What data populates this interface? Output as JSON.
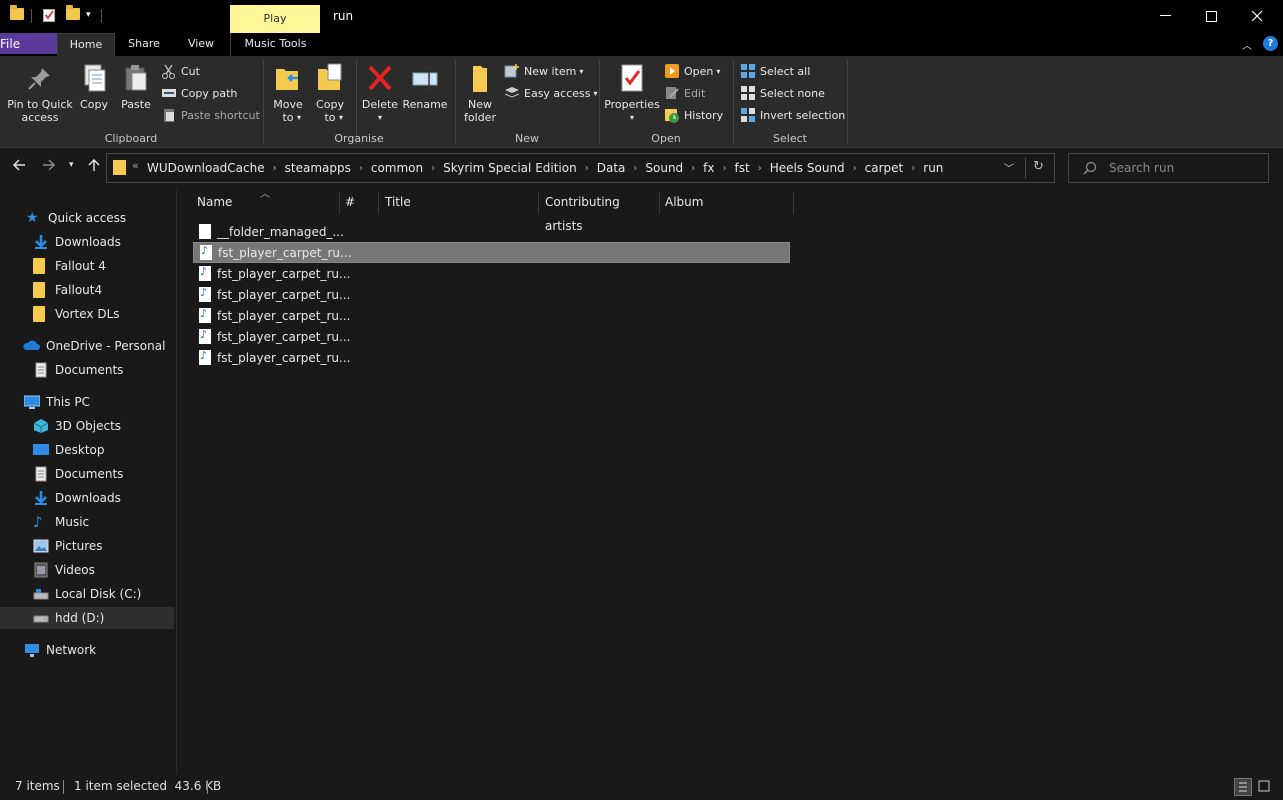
{
  "window": {
    "context_tab": "Play",
    "title": "run"
  },
  "tabs": {
    "file": "File",
    "home": "Home",
    "share": "Share",
    "view": "View",
    "music_tools": "Music Tools"
  },
  "ribbon": {
    "clipboard": {
      "label": "Clipboard",
      "pin": "Pin to Quick access",
      "copy": "Copy",
      "paste": "Paste",
      "cut": "Cut",
      "copy_path": "Copy path",
      "paste_shortcut": "Paste shortcut"
    },
    "organise": {
      "label": "Organise",
      "move_to": "Move to",
      "copy_to": "Copy to",
      "delete": "Delete",
      "rename": "Rename"
    },
    "new": {
      "label": "New",
      "new_folder": "New folder",
      "new_item": "New item",
      "easy_access": "Easy access"
    },
    "open": {
      "label": "Open",
      "properties": "Properties",
      "open": "Open",
      "edit": "Edit",
      "history": "History"
    },
    "select": {
      "label": "Select",
      "select_all": "Select all",
      "select_none": "Select none",
      "invert": "Invert selection"
    }
  },
  "address": {
    "crumbs": [
      "WUDownloadCache",
      "steamapps",
      "common",
      "Skyrim Special Edition",
      "Data",
      "Sound",
      "fx",
      "fst",
      "Heels Sound",
      "carpet",
      "run"
    ],
    "search_placeholder": "Search run"
  },
  "nav": {
    "quick_access": "Quick access",
    "qa_items": [
      "Downloads",
      "Fallout 4",
      "Fallout4",
      "Vortex DLs"
    ],
    "onedrive": "OneDrive - Personal",
    "onedrive_items": [
      "Documents"
    ],
    "this_pc": "This PC",
    "pc_items": [
      "3D Objects",
      "Desktop",
      "Documents",
      "Downloads",
      "Music",
      "Pictures",
      "Videos",
      "Local Disk (C:)",
      "hdd (D:)"
    ],
    "network": "Network"
  },
  "columns": [
    "Name",
    "#",
    "Title",
    "Contributing artists",
    "Album"
  ],
  "files": [
    {
      "name": "__folder_managed_...",
      "type": "generic"
    },
    {
      "name": "fst_player_carpet_ru...",
      "type": "music",
      "selected": true
    },
    {
      "name": "fst_player_carpet_ru...",
      "type": "music"
    },
    {
      "name": "fst_player_carpet_ru...",
      "type": "music"
    },
    {
      "name": "fst_player_carpet_ru...",
      "type": "music"
    },
    {
      "name": "fst_player_carpet_ru...",
      "type": "music"
    },
    {
      "name": "fst_player_carpet_ru...",
      "type": "music"
    }
  ],
  "status": {
    "count": "7 items",
    "selection": "1 item selected  43.6 KB"
  },
  "colors": {
    "file_tab": "#5c3a9c",
    "context_tab": "#fff799",
    "folder": "#f5cb4f",
    "selection": "#777777"
  }
}
